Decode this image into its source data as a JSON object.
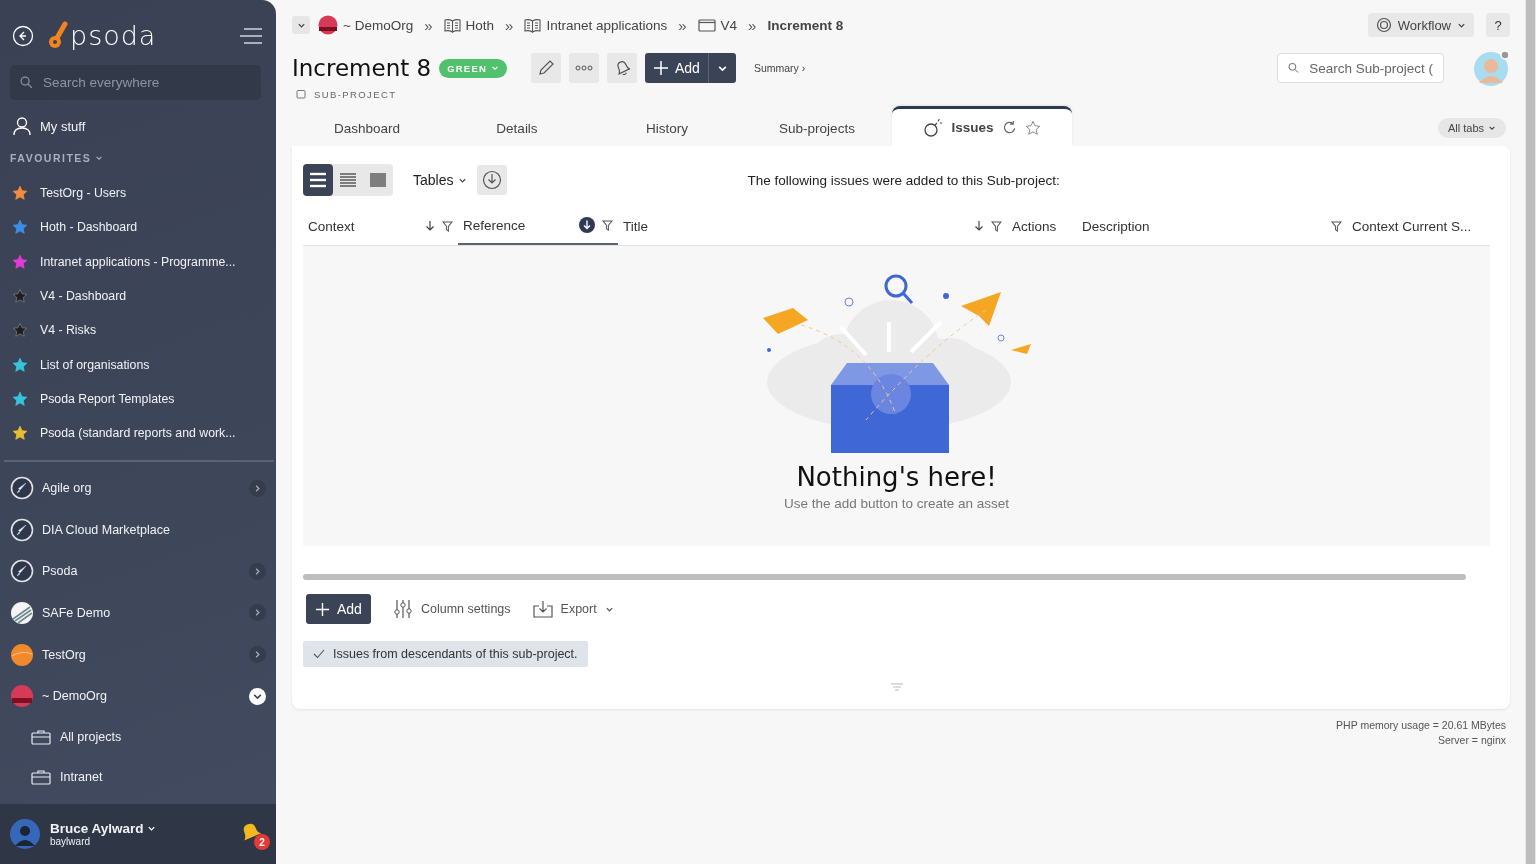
{
  "sidebar": {
    "logo": "psoda",
    "search": {
      "placeholder": "Search everywhere"
    },
    "my_stuff": "My stuff",
    "favourites_heading": "FAVOURITES",
    "favourites": [
      {
        "label": "TestOrg - Users",
        "color": "#f28c3a"
      },
      {
        "label": "Hoth - Dashboard",
        "color": "#3b8ee8"
      },
      {
        "label": "Intranet applications - Programme...",
        "color": "#e23ad6"
      },
      {
        "label": "V4 - Dashboard",
        "color": "#1e1e1e"
      },
      {
        "label": "V4 - Risks",
        "color": "#1e1e1e"
      },
      {
        "label": "List of organisations",
        "color": "#36c4dc"
      },
      {
        "label": "Psoda Report Templates",
        "color": "#36c4dc"
      },
      {
        "label": "Psoda (standard reports and work...",
        "color": "#e6be2e"
      }
    ],
    "orgs": [
      {
        "label": "Agile org",
        "kind": "rocket",
        "has_children": true,
        "expanded": false
      },
      {
        "label": "DIA Cloud Marketplace",
        "kind": "rocket",
        "has_children": false
      },
      {
        "label": "Psoda",
        "kind": "rocket",
        "has_children": true,
        "expanded": false
      },
      {
        "label": "SAFe Demo",
        "kind": "stripes",
        "has_children": true,
        "expanded": false
      },
      {
        "label": "TestOrg",
        "kind": "orange",
        "has_children": true,
        "expanded": false
      },
      {
        "label": "~ DemoOrg",
        "kind": "sunset",
        "has_children": true,
        "expanded": true,
        "children": [
          "All projects",
          "Intranet"
        ]
      }
    ],
    "user": {
      "name": "Bruce Aylward",
      "username": "baylward",
      "notifications": "2"
    }
  },
  "breadcrumbs": [
    {
      "label": "~ DemoOrg",
      "kind": "org"
    },
    {
      "separator": "»",
      "label": "Hoth",
      "kind": "book"
    },
    {
      "separator": "»",
      "label": "Intranet applications",
      "kind": "book"
    },
    {
      "separator": "»",
      "label": "V4",
      "kind": "folder"
    },
    {
      "separator": "»",
      "label": "Increment 8",
      "kind": "current"
    }
  ],
  "header": {
    "title": "Increment 8",
    "status": "GREEN",
    "type": "SUB-PROJECT",
    "add": "Add",
    "summary": "Summary ›",
    "workflow": "Workflow",
    "help": "?",
    "search": {
      "placeholder": "Search Sub-project ("
    }
  },
  "tabs": [
    {
      "label": "Dashboard",
      "selected": false
    },
    {
      "label": "Details",
      "selected": false
    },
    {
      "label": "History",
      "selected": false
    },
    {
      "label": "Sub-projects",
      "selected": false
    },
    {
      "label": "Issues",
      "selected": true
    }
  ],
  "all_tabs": "All tabs",
  "toolbar": {
    "view_modes": [
      {
        "kind": "comfortable",
        "selected": true
      },
      {
        "kind": "compact",
        "selected": false
      },
      {
        "kind": "dense",
        "selected": false
      }
    ],
    "tables": "Tables",
    "intro": "The following issues were added to this Sub-project:"
  },
  "table": {
    "columns": [
      {
        "label": "Context",
        "sort_arrow": true,
        "filter": true,
        "selected": false
      },
      {
        "label": "Reference",
        "sort_arrow": true,
        "filter": true,
        "selected": true
      },
      {
        "label": "Title",
        "sort_arrow": true,
        "filter": true,
        "selected": false
      },
      {
        "label": "Actions",
        "sort_arrow": false,
        "filter": false,
        "selected": false
      },
      {
        "label": "Description",
        "sort_arrow": false,
        "filter": true,
        "selected": false
      },
      {
        "label": "Context Current S...",
        "sort_arrow": false,
        "filter": false,
        "selected": false
      }
    ],
    "empty": {
      "title": "Nothing's here!",
      "text": "Use the add button to create an asset"
    }
  },
  "actions": {
    "add": "Add",
    "column_settings": "Column settings",
    "export": "Export"
  },
  "filter_chip": {
    "label": "Issues from descendants of this sub-project.",
    "checked": true
  },
  "footer": [
    "PHP memory usage = 20.61 MBytes",
    "Server = nginx"
  ]
}
